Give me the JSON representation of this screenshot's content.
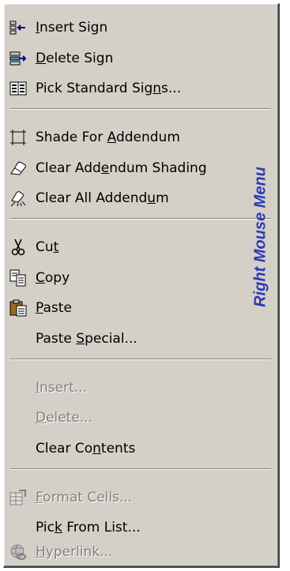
{
  "side_label": "Right Mouse Menu",
  "menu": {
    "insert_sign": {
      "pre": "",
      "key": "I",
      "post": "nsert Sign",
      "icon": "insert-sign-icon"
    },
    "delete_sign": {
      "pre": "",
      "key": "D",
      "post": "elete Sign",
      "icon": "delete-sign-icon"
    },
    "pick_standard_signs": {
      "pre": "Pick Standard Sig",
      "key": "n",
      "post": "s...",
      "icon": "pick-signs-icon"
    },
    "shade_for_addendum": {
      "pre": "Shade For ",
      "key": "A",
      "post": "ddendum",
      "icon": "shade-icon"
    },
    "clear_addendum_shading": {
      "pre": "Clear Add",
      "key": "e",
      "post": "ndum Shading",
      "icon": "eraser-icon"
    },
    "clear_all_addendum": {
      "pre": "Clear All Addend",
      "key": "u",
      "post": "m",
      "icon": "clear-all-icon"
    },
    "cut": {
      "pre": "Cu",
      "key": "t",
      "post": "",
      "icon": "scissors-icon"
    },
    "copy": {
      "pre": "",
      "key": "C",
      "post": "opy",
      "icon": "copy-icon"
    },
    "paste": {
      "pre": "",
      "key": "P",
      "post": "aste",
      "icon": "paste-icon"
    },
    "paste_special": {
      "pre": "Paste ",
      "key": "S",
      "post": "pecial..."
    },
    "insert": {
      "pre": "",
      "key": "I",
      "post": "nsert..."
    },
    "delete": {
      "pre": "",
      "key": "D",
      "post": "elete..."
    },
    "clear_contents": {
      "pre": "Clear Co",
      "key": "n",
      "post": "tents"
    },
    "format_cells": {
      "pre": "",
      "key": "F",
      "post": "ormat Cells...",
      "icon": "format-cells-icon"
    },
    "pick_from_list": {
      "pre": "Pic",
      "key": "k",
      "post": " From List..."
    },
    "hyperlink": {
      "pre": "",
      "key": "H",
      "post": "yperlink...",
      "icon": "hyperlink-icon"
    }
  }
}
